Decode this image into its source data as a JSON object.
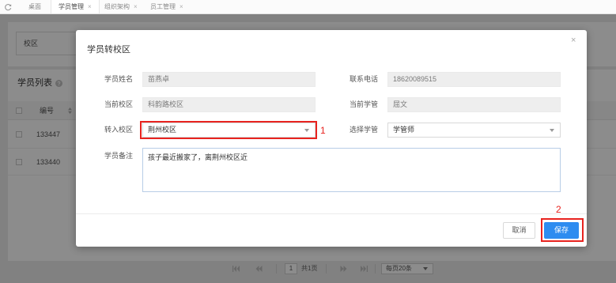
{
  "tabs": {
    "refresh_icon": "refresh-icon",
    "items": [
      {
        "label": "桌面"
      },
      {
        "label": "学员管理",
        "close": "×",
        "active": true
      },
      {
        "label": "组织架构",
        "close": "×"
      },
      {
        "label": "员工管理",
        "close": "×"
      }
    ]
  },
  "background": {
    "filter": {
      "campus": "校区"
    },
    "list": {
      "title": "学员列表",
      "help_icon": "help-icon",
      "columns": [
        {
          "label": "编号",
          "sort_icon": "sort-icon"
        }
      ],
      "rows": [
        {
          "id": "133447"
        },
        {
          "id": "133440"
        }
      ]
    },
    "pagination": {
      "icons": [
        "first-page-icon",
        "prev-page-icon",
        "next-page-icon",
        "last-page-icon"
      ],
      "current_page": "1",
      "total_pages": "共1页",
      "page_size": "每页20条",
      "page_size_icon": "caret-down-icon"
    }
  },
  "modal": {
    "title": "学员转校区",
    "close": "×",
    "fields": {
      "student_name": {
        "label": "学员姓名",
        "value": "苗燕卓"
      },
      "phone": {
        "label": "联系电话",
        "value": "18620089515"
      },
      "current_campus": {
        "label": "当前校区",
        "value": "科韵路校区"
      },
      "current_manager": {
        "label": "当前学管",
        "value": "屈文"
      },
      "target_campus": {
        "label": "转入校区",
        "value": "荆州校区",
        "icon": "caret-down-icon"
      },
      "select_manager": {
        "label": "选择学管",
        "value": "学管师",
        "icon": "caret-down-icon"
      },
      "remark": {
        "label": "学员备注",
        "value": "孩子最近搬家了，离荆州校区近"
      }
    },
    "footer": {
      "cancel_label": "取消",
      "save_label": "保存"
    }
  },
  "annotations": {
    "target_campus_marker": "1",
    "save_button_marker": "2"
  },
  "colors": {
    "primary": "#2d8cf0",
    "annotation": "#e8231f",
    "readonly_field": "#eeeeee"
  }
}
